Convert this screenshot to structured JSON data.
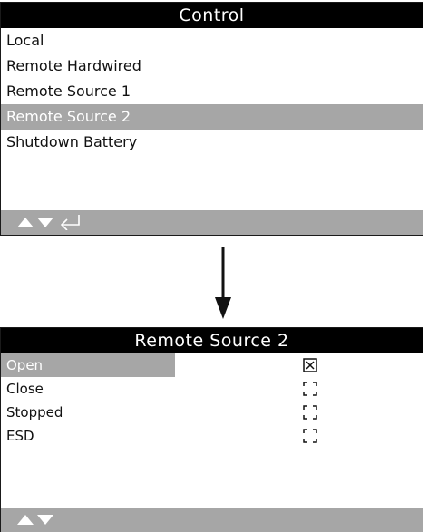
{
  "menu": {
    "title": "Control",
    "items": [
      {
        "label": "Local",
        "selected": false
      },
      {
        "label": "Remote Hardwired",
        "selected": false
      },
      {
        "label": "Remote Source 1",
        "selected": false
      },
      {
        "label": "Remote Source 2",
        "selected": true
      },
      {
        "label": "Shutdown Battery",
        "selected": false
      }
    ],
    "footer_icons": [
      "up-arrow-icon",
      "down-arrow-icon",
      "enter-icon"
    ]
  },
  "detail": {
    "title": "Remote Source 2",
    "items": [
      {
        "label": "Open",
        "checked": true,
        "selected": true
      },
      {
        "label": "Close",
        "checked": false,
        "selected": false
      },
      {
        "label": "Stopped",
        "checked": false,
        "selected": false
      },
      {
        "label": "ESD",
        "checked": false,
        "selected": false
      }
    ],
    "footer_icons": [
      "up-arrow-icon",
      "down-arrow-icon"
    ]
  },
  "colors": {
    "title_bg": "#000000",
    "highlight": "#a6a6a6",
    "footer": "#a6a6a6"
  }
}
